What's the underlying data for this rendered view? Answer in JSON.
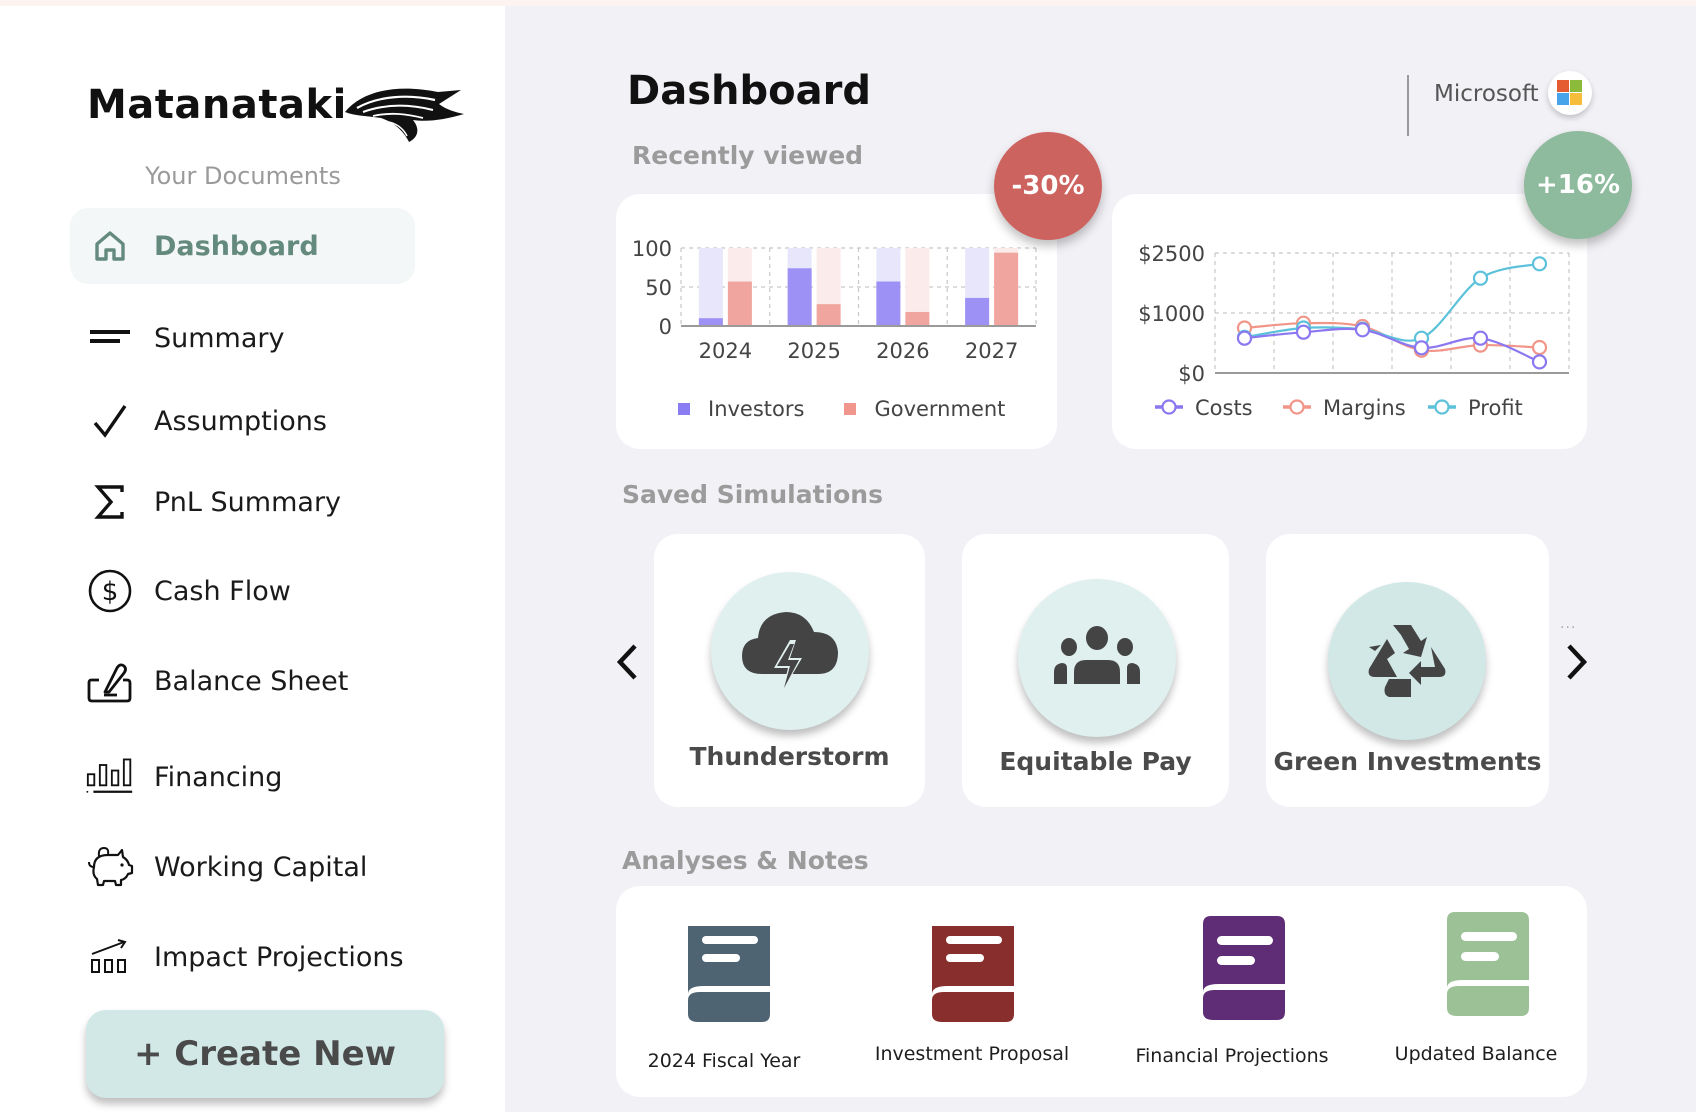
{
  "brand": {
    "name": "Matanataki",
    "logo_icon": "stylized-wave-bird-logo"
  },
  "sidebar": {
    "section_label": "Your Documents",
    "items": [
      {
        "label": "Dashboard",
        "icon": "home-icon",
        "active": true
      },
      {
        "label": "Summary",
        "icon": "short-text-lines-icon",
        "active": false
      },
      {
        "label": "Assumptions",
        "icon": "checkmark-icon",
        "active": false
      },
      {
        "label": "PnL Summary",
        "icon": "sigma-icon",
        "active": false
      },
      {
        "label": "Cash Flow",
        "icon": "dollar-circle-icon",
        "active": false
      },
      {
        "label": "Balance Sheet",
        "icon": "signature-pen-icon",
        "active": false
      },
      {
        "label": "Financing",
        "icon": "bar-chart-icon",
        "active": false
      },
      {
        "label": "Working Capital",
        "icon": "piggy-bank-icon",
        "active": false
      },
      {
        "label": "Impact Projections",
        "icon": "growth-chart-icon",
        "active": false
      }
    ],
    "create_button": "+ Create New"
  },
  "header": {
    "title": "Dashboard",
    "company": "Microsoft",
    "company_logo_colors": [
      "#e55b32",
      "#8cba3a",
      "#47a3ea",
      "#f6bd3a"
    ]
  },
  "recently_viewed": {
    "title": "Recently viewed",
    "bar_badge": {
      "text": "-30%",
      "color": "#cd635f"
    },
    "line_badge": {
      "text": "+16%",
      "color": "#8eba9d"
    }
  },
  "chart_data": [
    {
      "type": "bar",
      "title": "",
      "categories": [
        "2024",
        "2025",
        "2026",
        "2027"
      ],
      "series": [
        {
          "name": "Investors",
          "values": [
            10,
            74,
            57,
            36
          ],
          "color": "#9e91f5",
          "track_color": "#e8e6fb"
        },
        {
          "name": "Government",
          "values": [
            57,
            28,
            18,
            94
          ],
          "color": "#f1a59f",
          "track_color": "#fbeceb"
        }
      ],
      "yticks": [
        0,
        50,
        100
      ],
      "ylim": [
        0,
        100
      ],
      "grid": true,
      "legend": "bottom",
      "legend_colors": [
        "#8a7cf2",
        "#f0968c"
      ]
    },
    {
      "type": "line",
      "title": "",
      "x": [
        1,
        2,
        3,
        4,
        5,
        6
      ],
      "series": [
        {
          "name": "Costs",
          "values": [
            580,
            680,
            720,
            420,
            580,
            185
          ],
          "color": "#8b77f0"
        },
        {
          "name": "Margins",
          "values": [
            750,
            830,
            775,
            380,
            465,
            425
          ],
          "color": "#f19589"
        },
        {
          "name": "Profit",
          "values": [
            595,
            750,
            730,
            580,
            1870,
            2230
          ],
          "color": "#5cc1da"
        }
      ],
      "yticks": [
        "$0",
        "$1000",
        "$2500"
      ],
      "ytick_values": [
        0,
        1000,
        2500
      ],
      "ylim": [
        0,
        2500
      ],
      "grid": true,
      "legend": "bottom"
    }
  ],
  "saved_simulations": {
    "title": "Saved Simulations",
    "prev_icon": "chevron-left-icon",
    "next_icon": "chevron-right-icon",
    "more_indicator": "...",
    "items": [
      {
        "label": "Thunderstorm",
        "icon": "thunderstorm-cloud-icon",
        "circle_color": "#dff0ef"
      },
      {
        "label": "Equitable Pay",
        "icon": "group-people-icon",
        "circle_color": "#dff0ef"
      },
      {
        "label": "Green Investments",
        "icon": "recycle-icon",
        "circle_color": "#d1e8e6"
      }
    ]
  },
  "analyses": {
    "title": "Analyses & Notes",
    "items": [
      {
        "label": "2024 Fiscal Year",
        "icon": "book-icon",
        "color": "#4f6473"
      },
      {
        "label": "Investment Proposal",
        "icon": "book-icon",
        "color": "#882e2d"
      },
      {
        "label": "Financial Projections",
        "icon": "book-icon",
        "color": "#5e2d75"
      },
      {
        "label": "Updated Balance",
        "icon": "book-icon",
        "color": "#9cc197"
      }
    ]
  }
}
